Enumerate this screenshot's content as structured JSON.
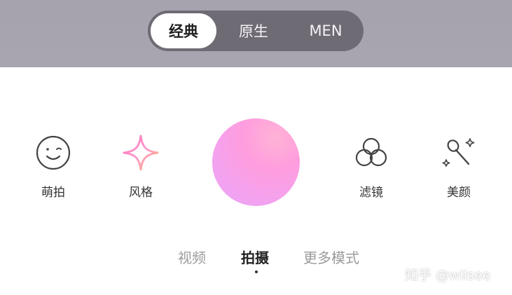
{
  "mode_switch": {
    "options": [
      {
        "label": "经典",
        "active": true
      },
      {
        "label": "原生",
        "active": false
      },
      {
        "label": "MEN",
        "active": false
      }
    ]
  },
  "tools": [
    {
      "label": "萌拍",
      "icon": "smiley-face-icon"
    },
    {
      "label": "风格",
      "icon": "sparkle-star-icon"
    },
    {
      "label": "滤镜",
      "icon": "three-circles-icon"
    },
    {
      "label": "美颜",
      "icon": "magic-wand-icon"
    }
  ],
  "shutter": {
    "icon": "shutter-button"
  },
  "tabs": [
    {
      "label": "视频",
      "active": false
    },
    {
      "label": "拍摄",
      "active": true
    },
    {
      "label": "更多模式",
      "active": false
    }
  ],
  "watermark": "知乎 @wlisee",
  "colors": {
    "top_band": "#a8a4b0",
    "switch_bg": "#6f6b74",
    "shutter_pink": "#ff9dde",
    "shutter_lavender": "#e7a6f6"
  }
}
